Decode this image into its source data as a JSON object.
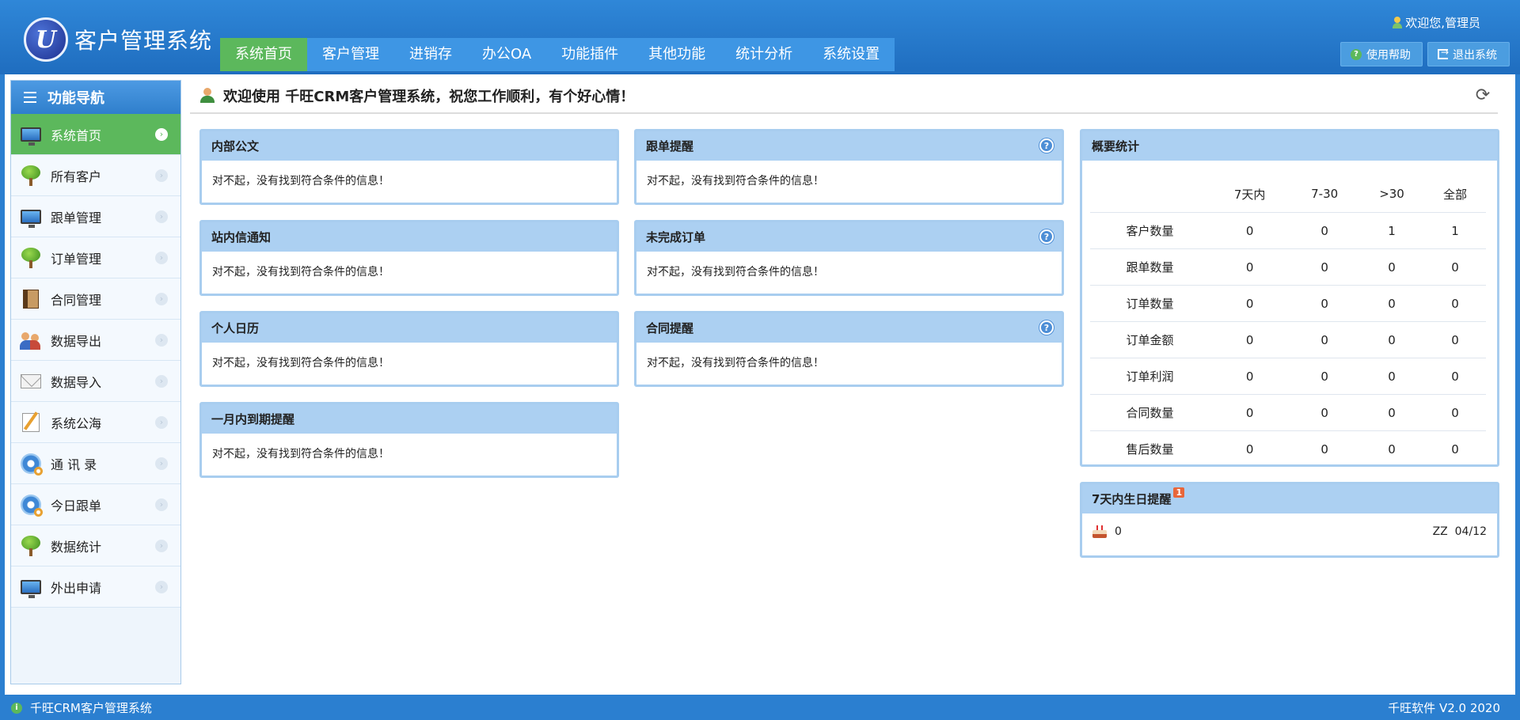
{
  "app": {
    "logo_letter": "U",
    "title": "客户管理系统"
  },
  "topnav": [
    {
      "label": "系统首页",
      "active": true
    },
    {
      "label": "客户管理"
    },
    {
      "label": "进销存"
    },
    {
      "label": "办公OA"
    },
    {
      "label": "功能插件"
    },
    {
      "label": "其他功能"
    },
    {
      "label": "统计分析"
    },
    {
      "label": "系统设置"
    }
  ],
  "header": {
    "welcome": "欢迎您,管理员",
    "help_label": "使用帮助",
    "exit_label": "退出系统"
  },
  "sidebar": {
    "title": "功能导航",
    "items": [
      {
        "label": "系统首页",
        "icon": "monitor-icon",
        "active": true
      },
      {
        "label": "所有客户",
        "icon": "tree-icon"
      },
      {
        "label": "跟单管理",
        "icon": "monitor-icon"
      },
      {
        "label": "订单管理",
        "icon": "tree-icon"
      },
      {
        "label": "合同管理",
        "icon": "book-icon"
      },
      {
        "label": "数据导出",
        "icon": "people-icon"
      },
      {
        "label": "数据导入",
        "icon": "mail-icon"
      },
      {
        "label": "系统公海",
        "icon": "note-icon"
      },
      {
        "label": "通 讯 录",
        "icon": "gear-icon"
      },
      {
        "label": "今日跟单",
        "icon": "gear-icon"
      },
      {
        "label": "数据统计",
        "icon": "tree-icon"
      },
      {
        "label": "外出申请",
        "icon": "monitor-icon"
      }
    ]
  },
  "main": {
    "welcome_title": "欢迎使用 千旺CRM客户管理系统，祝您工作顺利，有个好心情！",
    "empty_msg": "对不起，没有找到符合条件的信息！"
  },
  "panels": {
    "p1": {
      "title": "内部公文"
    },
    "p2": {
      "title": "跟单提醒"
    },
    "p3": {
      "title": "站内信通知"
    },
    "p4": {
      "title": "未完成订单"
    },
    "p5": {
      "title": "个人日历"
    },
    "p6": {
      "title": "合同提醒"
    },
    "p7": {
      "title": "一月内到期提醒"
    }
  },
  "stats": {
    "title": "概要统计",
    "columns": [
      "",
      "7天内",
      "7-30",
      ">30",
      "全部"
    ],
    "rows": [
      {
        "label": "客户数量",
        "values": [
          "0",
          "0",
          "1",
          "1"
        ]
      },
      {
        "label": "跟单数量",
        "values": [
          "0",
          "0",
          "0",
          "0"
        ]
      },
      {
        "label": "订单数量",
        "values": [
          "0",
          "0",
          "0",
          "0"
        ]
      },
      {
        "label": "订单金额",
        "values": [
          "0",
          "0",
          "0",
          "0"
        ]
      },
      {
        "label": "订单利润",
        "values": [
          "0",
          "0",
          "0",
          "0"
        ]
      },
      {
        "label": "合同数量",
        "values": [
          "0",
          "0",
          "0",
          "0"
        ]
      },
      {
        "label": "售后数量",
        "values": [
          "0",
          "0",
          "0",
          "0"
        ]
      }
    ]
  },
  "birthday": {
    "title": "7天内生日提醒",
    "badge": "1",
    "count": "0",
    "name_date": "ZZ  04/12"
  },
  "footer": {
    "left": "千旺CRM客户管理系统",
    "right": "千旺软件 V2.0 2020"
  }
}
